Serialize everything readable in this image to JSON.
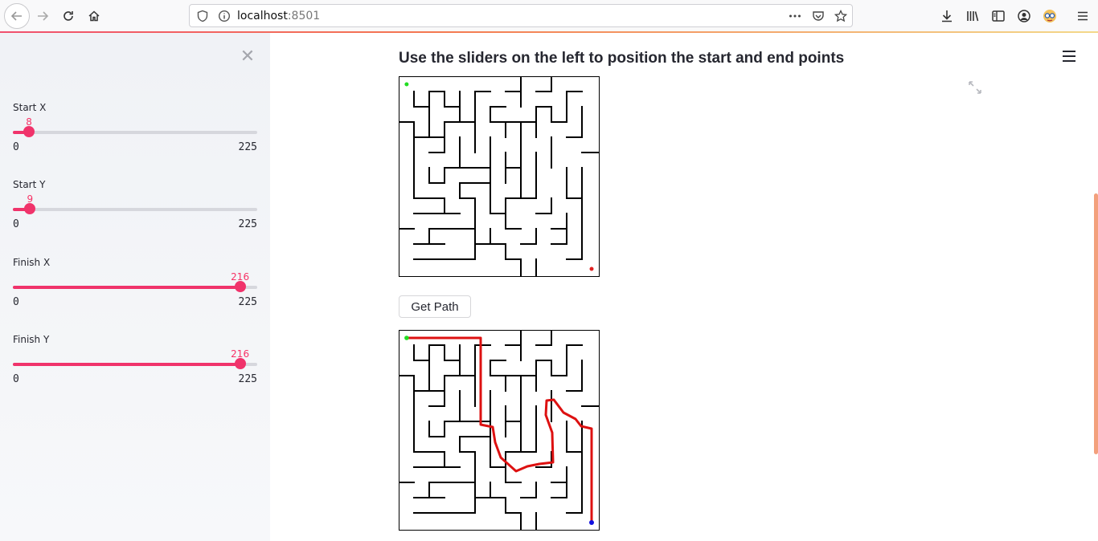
{
  "browser": {
    "url_host": "localhost",
    "url_port": ":8501"
  },
  "sidebar": {
    "close_symbol": "✕",
    "sliders": [
      {
        "label": "Start X",
        "value": 8,
        "min": 0,
        "max": 225
      },
      {
        "label": "Start Y",
        "value": 9,
        "min": 0,
        "max": 225
      },
      {
        "label": "Finish X",
        "value": 216,
        "min": 0,
        "max": 225
      },
      {
        "label": "Finish Y",
        "value": 216,
        "min": 0,
        "max": 225
      }
    ]
  },
  "main": {
    "title": "Use the sliders on the left to position the start and end points",
    "get_path_label": "Get Path"
  },
  "colors": {
    "accent": "#f0336b",
    "start_marker": "#22dd22",
    "end_marker_before": "#e02020",
    "end_marker_after": "#1010e0",
    "path": "#dd1111"
  },
  "icons": [
    "back-arrow-icon",
    "forward-arrow-icon",
    "reload-icon",
    "home-icon",
    "shield-icon",
    "info-icon",
    "more-icon",
    "pocket-icon",
    "star-icon",
    "download-icon",
    "library-icon",
    "reader-icon",
    "account-icon",
    "extension-icon",
    "menu-icon",
    "fullscreen-icon",
    "hamburger-icon",
    "close-icon"
  ]
}
